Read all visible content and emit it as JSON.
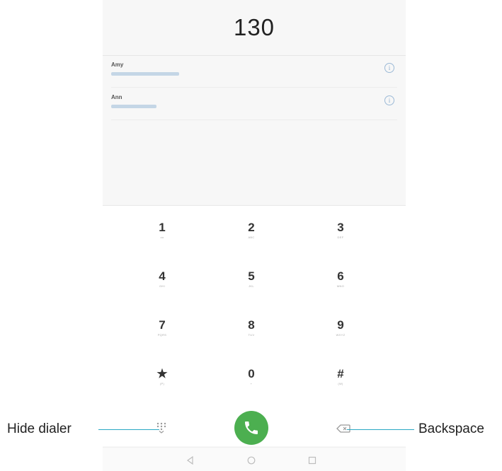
{
  "dialer": {
    "number": "130",
    "suggestions": [
      {
        "name": "Amy"
      },
      {
        "name": "Ann"
      }
    ],
    "keys": [
      {
        "digit": "1",
        "letters": "oo"
      },
      {
        "digit": "2",
        "letters": "ABC"
      },
      {
        "digit": "3",
        "letters": "DEF"
      },
      {
        "digit": "4",
        "letters": "GHI"
      },
      {
        "digit": "5",
        "letters": "JKL"
      },
      {
        "digit": "6",
        "letters": "MNO"
      },
      {
        "digit": "7",
        "letters": "PQRS"
      },
      {
        "digit": "8",
        "letters": "TUV"
      },
      {
        "digit": "9",
        "letters": "WXYZ"
      },
      {
        "digit": "★",
        "letters": "(P)"
      },
      {
        "digit": "0",
        "letters": "+"
      },
      {
        "digit": "#",
        "letters": "(W)"
      }
    ]
  },
  "callouts": {
    "hide_dialer": "Hide dialer",
    "backspace": "Backspace"
  },
  "colors": {
    "call_button": "#4caf50",
    "callout_line": "#2aa8c4"
  },
  "icons": {
    "call": "phone-icon",
    "hide_dialer": "dialpad-hide-icon",
    "backspace": "backspace-icon",
    "info": "info-icon",
    "nav_back": "back-triangle-icon",
    "nav_home": "home-circle-icon",
    "nav_recents": "recents-square-icon"
  }
}
